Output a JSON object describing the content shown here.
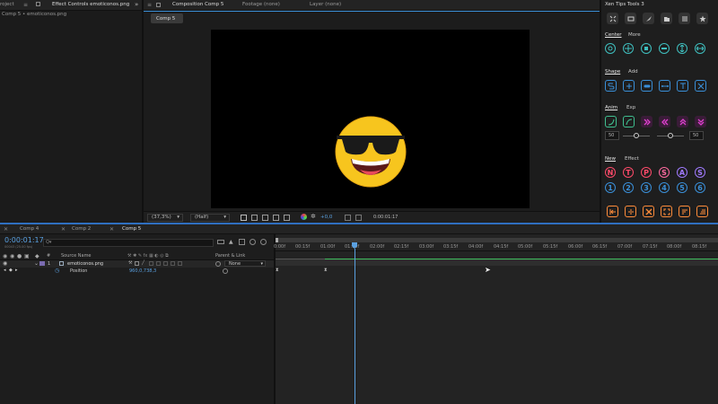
{
  "top_tabs": {
    "project": "roject",
    "effect_controls": "Effect Controls emoticonos.png",
    "composition": "Composition Comp 5",
    "footage": "Footage (none)",
    "layer": "Layer (none)"
  },
  "effect_controls_subtitle": "Comp 5 • emoticonos.png",
  "viewer": {
    "comp_button": "Comp 5",
    "zoom": "(37,3%)",
    "resolution": "(Half)",
    "exposure": "+0,0",
    "timecode": "0:00:01:17"
  },
  "xen": {
    "title": "Xen Tips Tools 3",
    "tabs_center": [
      "Center",
      "More"
    ],
    "tabs_shape": [
      "Shape",
      "Add"
    ],
    "tabs_anim": [
      "Anim",
      "Exp"
    ],
    "tabs_new": [
      "New",
      "Effect"
    ],
    "anim_val_left": "50",
    "anim_val_right": "50",
    "letters": [
      "N",
      "T",
      "P",
      "S",
      "A",
      "S"
    ],
    "numbers": [
      "1",
      "2",
      "3",
      "4",
      "5",
      "6"
    ],
    "colors": {
      "accent": "#3a8fd8",
      "pink": "#e040d0",
      "green": "#3fbf8f",
      "red": "#ff5a5a",
      "orange": "#ff8c3a"
    }
  },
  "timeline": {
    "tabs": [
      "Comp 4",
      "Comp 2",
      "Comp 5"
    ],
    "timecode": "0:00:01:17",
    "frames_info": "00043 (25.00 fps)",
    "search_placeholder": "Q▾",
    "col_source_name": "Source Name",
    "col_parent": "Parent & Link",
    "col_hash": "#",
    "layer_num": "1",
    "layer_name": "emoticonos.png",
    "parent_value": "None",
    "property_name": "Position",
    "property_value": "960,0,738,3",
    "ruler": [
      "0:00f",
      "00:15f",
      "01:00f",
      "01:15f",
      "02:00f",
      "02:15f",
      "03:00f",
      "03:15f",
      "04:00f",
      "04:15f",
      "05:00f",
      "05:15f",
      "06:00f",
      "06:15f",
      "07:00f",
      "07:15f",
      "08:00f",
      "08:15f"
    ]
  }
}
